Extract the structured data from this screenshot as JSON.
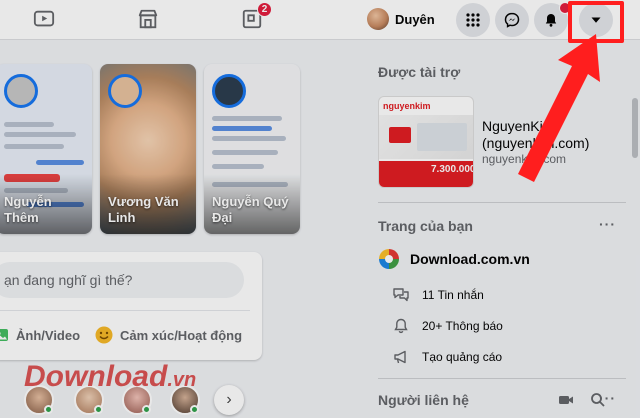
{
  "topbar": {
    "nav": [
      {
        "name": "watch",
        "icon": "video-play-icon"
      },
      {
        "name": "marketplace",
        "icon": "store-icon"
      },
      {
        "name": "gaming",
        "icon": "gaming-icon",
        "badge": "2"
      }
    ],
    "profile_name": "Duyên",
    "buttons": [
      "menu-grid-icon",
      "messenger-icon",
      "notifications-icon",
      "account-dropdown-icon"
    ]
  },
  "stories": [
    {
      "name": "Nguyễn Thêm"
    },
    {
      "name": "Vương Văn Linh"
    },
    {
      "name": "Nguyễn Quý Đại"
    }
  ],
  "composer": {
    "placeholder": "ạn đang nghĩ gì thế?",
    "actions": [
      "Ảnh/Video",
      "Cảm xúc/Hoạt động"
    ]
  },
  "sponsored": {
    "title": "Được tài trợ",
    "ad_name": "NguyenKim (nguyenkim.com)",
    "ad_url": "nguyenkim.com",
    "ad_brand": "nguyenkim",
    "ad_price": "7.300.000"
  },
  "pages": {
    "title": "Trang của bạn",
    "page_name": "Download.com.vn",
    "items": [
      "11 Tin nhắn",
      "20+ Thông báo",
      "Tạo quảng cáo"
    ]
  },
  "contacts": {
    "title": "Người liên hệ"
  },
  "watermark": {
    "text": "Download",
    "suffix": ".vn"
  },
  "colors": {
    "accent": "#1877f2",
    "highlight": "#ff1e1e",
    "badge": "#e41e3f"
  }
}
